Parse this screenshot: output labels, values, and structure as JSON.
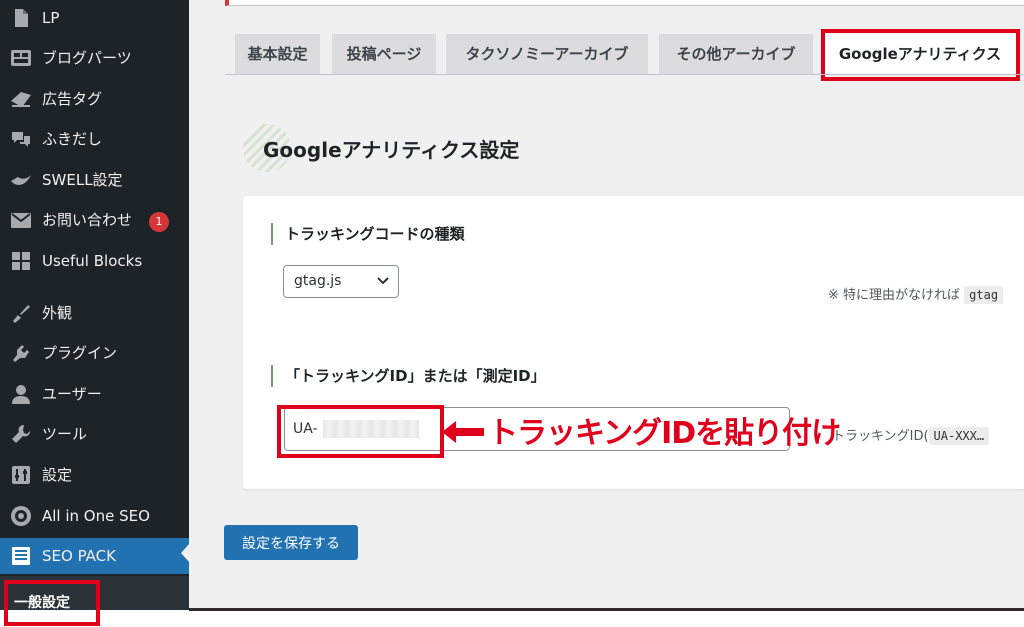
{
  "sidebar": {
    "items": [
      {
        "label": "LP",
        "icon": "page-icon"
      },
      {
        "label": "ブログパーツ",
        "icon": "blocks-icon"
      },
      {
        "label": "広告タグ",
        "icon": "ad-tag-icon"
      },
      {
        "label": "ふきだし",
        "icon": "speech-bubble-icon"
      },
      {
        "label": "SWELL設定",
        "icon": "swell-icon"
      },
      {
        "label": "お問い合わせ",
        "icon": "mail-icon",
        "badge": "1"
      },
      {
        "label": "Useful Blocks",
        "icon": "grid-icon"
      },
      {
        "label": "外観",
        "icon": "brush-icon"
      },
      {
        "label": "プラグイン",
        "icon": "plugin-icon"
      },
      {
        "label": "ユーザー",
        "icon": "user-icon"
      },
      {
        "label": "ツール",
        "icon": "wrench-icon"
      },
      {
        "label": "設定",
        "icon": "sliders-icon"
      },
      {
        "label": "All in One SEO",
        "icon": "aioseo-icon"
      },
      {
        "label": "SEO PACK",
        "icon": "list-icon",
        "active": true
      }
    ],
    "submenu_label": "一般設定"
  },
  "tabs": [
    {
      "label": "基本設定"
    },
    {
      "label": "投稿ページ"
    },
    {
      "label": "タクソノミーアーカイブ"
    },
    {
      "label": "その他アーカイブ"
    },
    {
      "label": "Googleアナリティクス",
      "active": true
    }
  ],
  "section": {
    "title": "Googleアナリティクス設定"
  },
  "fields": {
    "code_type": {
      "label": "トラッキングコードの種類",
      "selected": "gtag.js",
      "note_prefix": "※ 特に理由がなければ",
      "note_code": "gtag"
    },
    "tracking_id": {
      "label": "「トラッキングID」または「測定ID」",
      "value": "UA-",
      "note_prefix": "トラッキングID(",
      "note_code": "UA-XXX…"
    }
  },
  "annotation": {
    "text": "トラッキングIDを貼り付け"
  },
  "save_button": {
    "label": "設定を保存する"
  },
  "colors": {
    "sidebar_bg": "#1d2327",
    "active_menu": "#2271b1",
    "highlight_red": "#e0001b",
    "main_bg": "#f0f0f1"
  }
}
